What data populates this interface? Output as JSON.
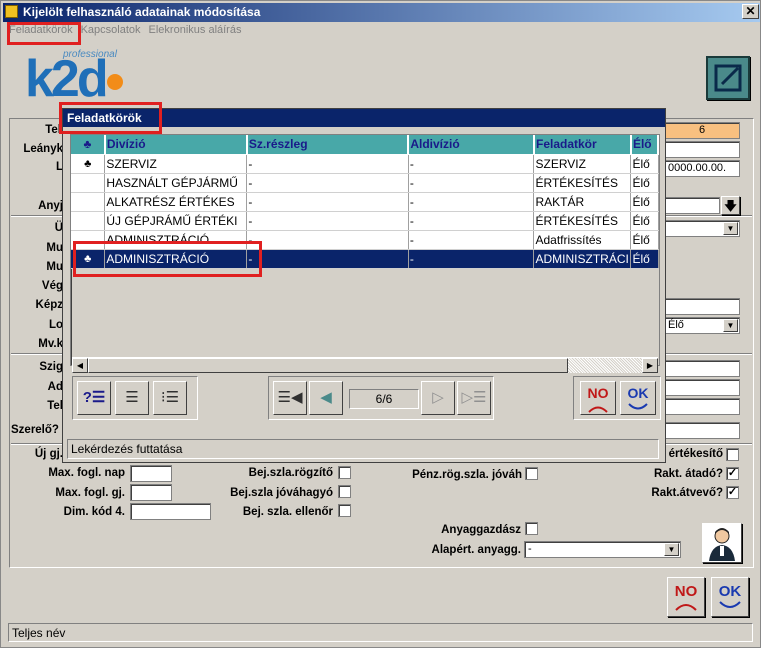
{
  "window": {
    "title": "Kijelölt felhasználó adatainak módosítása",
    "close_glyph": "✕"
  },
  "menu": {
    "items": [
      "Feladatkörök",
      "Kapcsolatok",
      "Elekronikus aláírás"
    ]
  },
  "logo": {
    "small_text": "professional",
    "main_text": "k2d"
  },
  "background_form": {
    "left_labels": [
      "Tel",
      "Leányk",
      "L",
      "Anyj",
      "Ü",
      "Mu",
      "Mu",
      "Vég",
      "Képz",
      "Lo",
      "Mv.k",
      "Szig",
      "Ad",
      "Tel"
    ],
    "right_values": {
      "field1": "6",
      "field2": "",
      "date": "0000.00.00.",
      "status": "Élő"
    },
    "szerelo_label": "Szerelő?",
    "uj_gj_label": "Új gj.",
    "ertekesito_label": "értékesítő",
    "max_fogl_nap_label": "Max. fogl. nap",
    "max_fogl_gj_label": "Max. fogl. gj.",
    "dim_kod_label": "Dim. kód 4.",
    "bej_szla_rogzito_label": "Bej.szla.rögzítő",
    "bej_szla_jovahagyo_label": "Bej.szla jóváhagyó",
    "bej_szla_ellenor_label": "Bej. szla. ellenőr",
    "penz_rog_label": "Pénz.rög.szla. jóváh",
    "rakt_atado_label": "Rakt. átadó?",
    "rakt_atado_checked": "✓",
    "rakt_atvevo_label": "Rakt.átvevő?",
    "rakt_atvevo_checked": "✓",
    "anyaggazdasz_label": "Anyaggazdász",
    "alapert_anyagg_label": "Alapért. anyagg.",
    "alapert_anyagg_value": "-"
  },
  "modal": {
    "title": "Feladatkörök",
    "columns": [
      "",
      "Divízió",
      "Sz.részleg",
      "Aldivízió",
      "Feladatkör",
      "Élő"
    ],
    "rows": [
      {
        "mark": "♣",
        "divizio": "SZERVIZ",
        "reszleg": "-",
        "aldivizio": "-",
        "feladatkor": "SZERVIZ",
        "elo": "Élő"
      },
      {
        "mark": "",
        "divizio": "HASZNÁLT GÉPJÁRMŰ",
        "reszleg": "-",
        "aldivizio": "-",
        "feladatkor": "ÉRTÉKESÍTÉS",
        "elo": "Élő"
      },
      {
        "mark": "",
        "divizio": "ALKATRÉSZ ÉRTÉKES",
        "reszleg": "-",
        "aldivizio": "-",
        "feladatkor": "RAKTÁR",
        "elo": "Élő"
      },
      {
        "mark": "",
        "divizio": "ÚJ GÉPJRÁMŰ ÉRTÉKI",
        "reszleg": "-",
        "aldivizio": "-",
        "feladatkor": "ÉRTÉKESÍTÉS",
        "elo": "Élő"
      },
      {
        "mark": "",
        "divizio": "ADMINISZTRÁCIÓ",
        "reszleg": "-",
        "aldivizio": "-",
        "feladatkor": "Adatfrissítés",
        "elo": "Élő"
      },
      {
        "mark": "♣",
        "divizio": "ADMINISZTRÁCIÓ",
        "reszleg": "-",
        "aldivizio": "-",
        "feladatkor": "ADMINISZTRÁCI",
        "elo": "Élő",
        "selected": true
      }
    ],
    "page_indicator": "6/6",
    "status_text": "Lekérdezés futtatása",
    "no_label": "NO",
    "ok_label": "OK"
  },
  "footer": {
    "no_label": "NO",
    "ok_label": "OK",
    "status_text": "Teljes név"
  },
  "colors": {
    "title_blue": "#0a246a",
    "header_teal": "#48a8a8",
    "highlight_red": "#e02020",
    "window_gray": "#d4d0c8"
  }
}
